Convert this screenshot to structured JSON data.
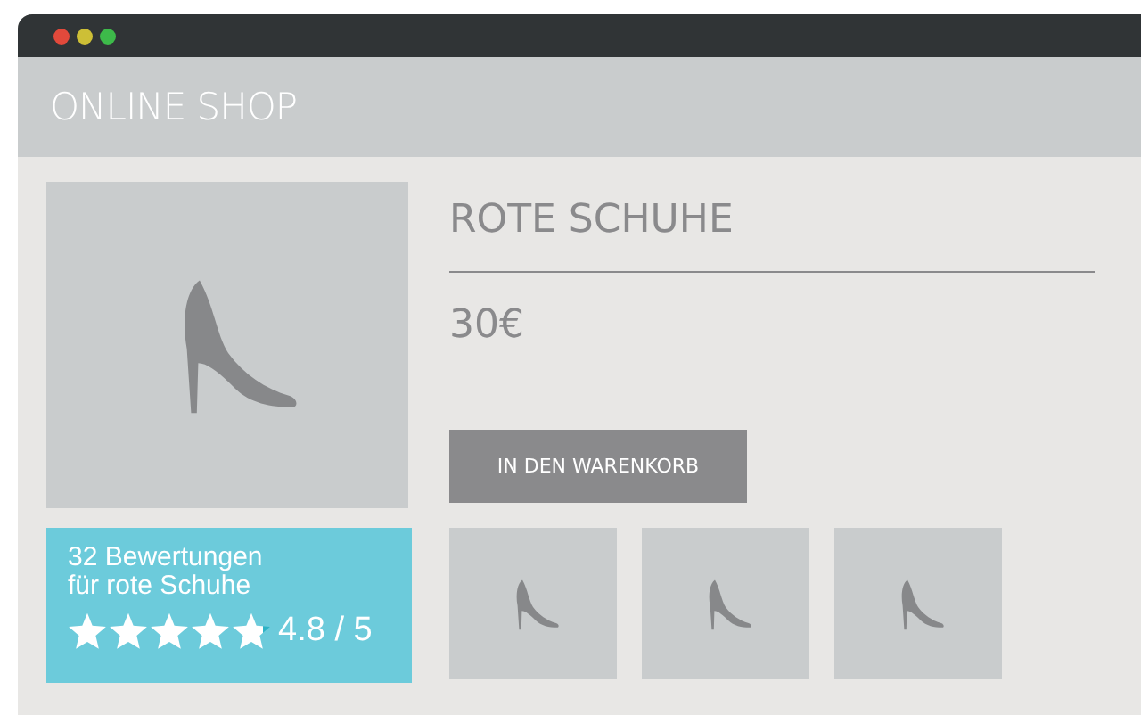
{
  "header": {
    "title": "ONLINE SHOP"
  },
  "product": {
    "name": "ROTE SCHUHE",
    "price": "30€",
    "button": "IN DEN WARENKORB"
  },
  "rating": {
    "count_text": "32 Bewertungen",
    "subject_text": "für rote Schuhe",
    "stars": 4.8,
    "score": "4.8 / 5"
  },
  "thumbnails": [
    {
      "kind": "shoe"
    },
    {
      "kind": "shoe"
    },
    {
      "kind": "shoe"
    }
  ]
}
